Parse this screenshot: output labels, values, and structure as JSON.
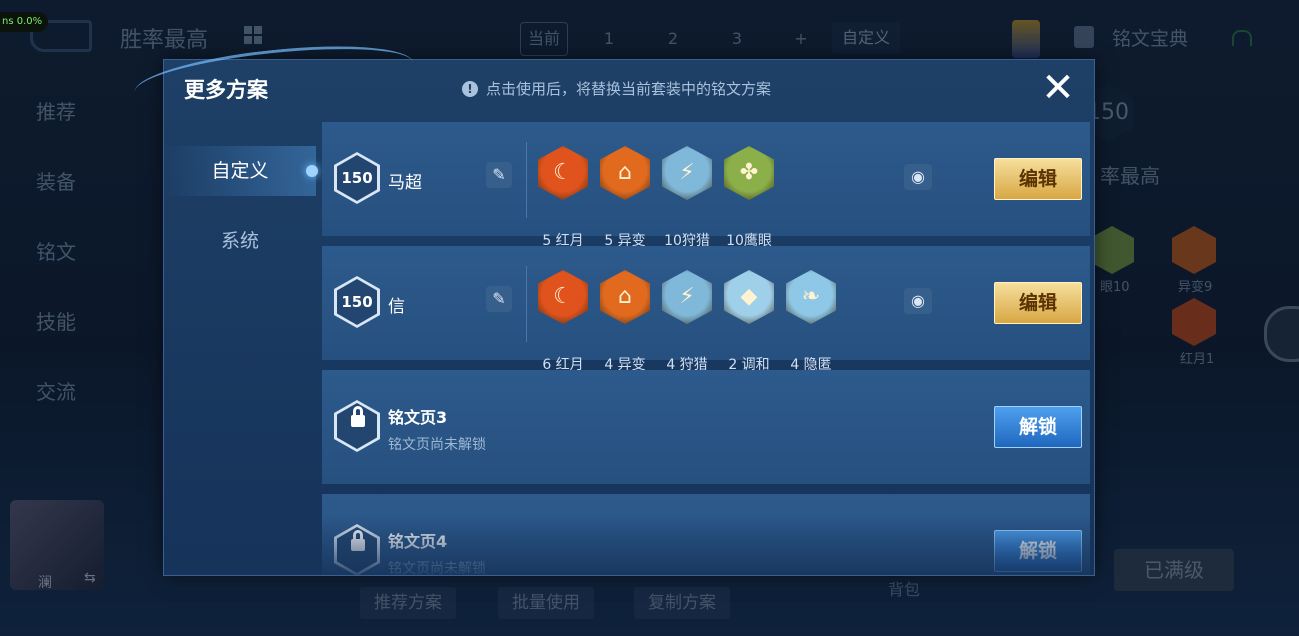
{
  "fps_text": "ns 0.0%",
  "background": {
    "title": "胜率最高",
    "tabs": [
      "当前",
      "1",
      "2",
      "3",
      "+"
    ],
    "custom_button": "自定义",
    "treasure": "铭文宝典",
    "side_menu": [
      "推荐",
      "装备",
      "铭文",
      "技能",
      "交流"
    ],
    "avatar_name": "澜",
    "avatar_swap": "⇆",
    "bottom_buttons": [
      "推荐方案",
      "批量使用",
      "复制方案"
    ],
    "bag": "背包",
    "maxed_button": "已满级",
    "level": "150",
    "best_label": "率最高",
    "rune_labels": [
      "眼10",
      "异变9",
      "红月1"
    ]
  },
  "modal": {
    "title": "更多方案",
    "notice": "点击使用后，将替换当前套装中的铭文方案",
    "close_glyph": "✕",
    "tabs": [
      {
        "label": "自定义",
        "active": true
      },
      {
        "label": "系统",
        "active": false
      }
    ],
    "sets": [
      {
        "level": "150",
        "hero": "马超",
        "edit_label": "编辑",
        "runes": [
          {
            "label": "5 红月",
            "color": "#e0531c",
            "glyph": "☾"
          },
          {
            "label": "5 异变",
            "color": "#e26a1e",
            "glyph": "⌂"
          },
          {
            "label": "10狩猎",
            "color": "#7fb8d8",
            "glyph": "⚡"
          },
          {
            "label": "10鹰眼",
            "color": "#8bb04a",
            "glyph": "✤"
          }
        ]
      },
      {
        "level": "150",
        "hero": "信",
        "edit_label": "编辑",
        "runes": [
          {
            "label": "6 红月",
            "color": "#e0531c",
            "glyph": "☾"
          },
          {
            "label": "4 异变",
            "color": "#e26a1e",
            "glyph": "⌂"
          },
          {
            "label": "4 狩猎",
            "color": "#7fb8d8",
            "glyph": "⚡"
          },
          {
            "label": "2 调和",
            "color": "#9fd0ea",
            "glyph": "◆"
          },
          {
            "label": "4 隐匿",
            "color": "#8ec8e6",
            "glyph": "❧"
          }
        ]
      }
    ],
    "locked_pages": [
      {
        "title": "铭文页3",
        "subtitle": "铭文页尚未解锁",
        "button": "解锁"
      },
      {
        "title": "铭文页4",
        "subtitle": "铭文页尚未解锁",
        "button": "解锁"
      }
    ],
    "pen_icon": "✎",
    "eye_icon": "◉"
  }
}
